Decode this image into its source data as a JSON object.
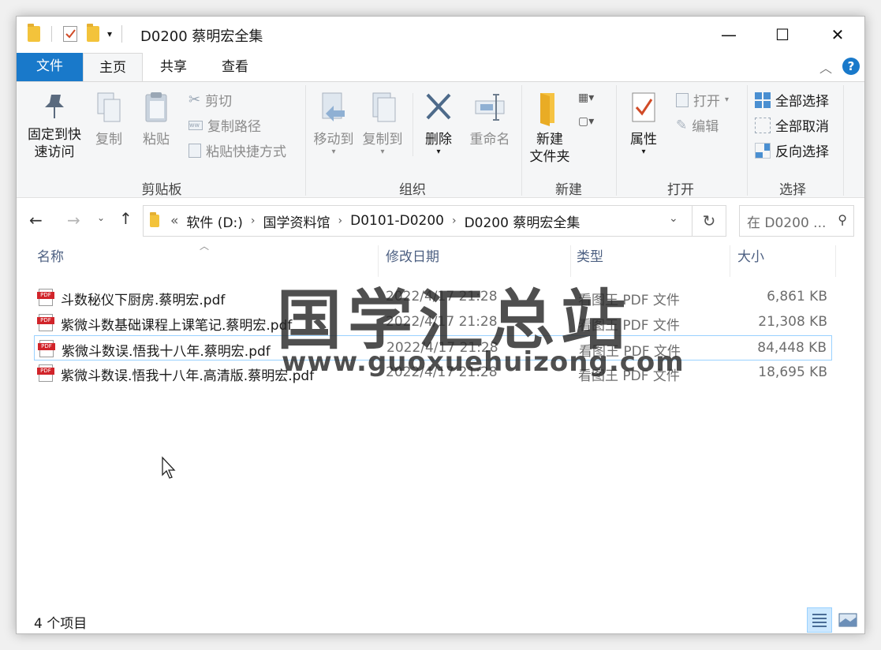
{
  "window": {
    "title": "D0200 蔡明宏全集",
    "controls": {
      "minimize": "—",
      "maximize": "☐",
      "close": "✕"
    }
  },
  "tabs": {
    "file": "文件",
    "home": "主页",
    "share": "共享",
    "view": "查看",
    "help": "?"
  },
  "ribbon": {
    "clipboard": {
      "label": "剪贴板",
      "pin": "固定到快速访问",
      "pin_l1": "固定到快",
      "pin_l2": "速访问",
      "copy": "复制",
      "paste": "粘贴",
      "cut": "剪切",
      "copy_path": "复制路径",
      "paste_shortcut": "粘贴快捷方式"
    },
    "organize": {
      "label": "组织",
      "move_to": "移动到",
      "copy_to": "复制到",
      "delete": "删除",
      "rename": "重命名"
    },
    "new": {
      "label": "新建",
      "new_folder_l1": "新建",
      "new_folder_l2": "文件夹"
    },
    "open": {
      "label": "打开",
      "properties": "属性",
      "open": "打开",
      "edit": "编辑"
    },
    "select": {
      "label": "选择",
      "select_all": "全部选择",
      "select_none": "全部取消",
      "invert": "反向选择"
    }
  },
  "address": {
    "overflow": "«",
    "crumbs": [
      "软件 (D:)",
      "国学资料馆",
      "D0101-D0200",
      "D0200 蔡明宏全集"
    ],
    "search_placeholder": "在 D0200 ..."
  },
  "columns": {
    "name": "名称",
    "date": "修改日期",
    "type": "类型",
    "size": "大小"
  },
  "files": [
    {
      "name": "斗数秘仪下厨房.蔡明宏.pdf",
      "date": "2022/4/17 21:28",
      "type": "看图王 PDF 文件",
      "size": "6,861 KB"
    },
    {
      "name": "紫微斗数基础课程上课笔记.蔡明宏.pdf",
      "date": "2022/4/17 21:28",
      "type": "看图王 PDF 文件",
      "size": "21,308 KB"
    },
    {
      "name": "紫微斗数误.悟我十八年.蔡明宏.pdf",
      "date": "2022/4/17 21:28",
      "type": "看图王 PDF 文件",
      "size": "84,448 KB"
    },
    {
      "name": "紫微斗数误.悟我十八年.高清版.蔡明宏.pdf",
      "date": "2022/4/17 21:28",
      "type": "看图王 PDF 文件",
      "size": "18,695 KB"
    }
  ],
  "selected_index": 2,
  "status": {
    "count": "4 个项目"
  },
  "watermark": {
    "title": "国学汇总站",
    "url": "www.guoxuehuizong.com"
  },
  "colors": {
    "accent": "#1979ca",
    "selection_border": "#99d1ff",
    "header_text": "#4d6082"
  }
}
